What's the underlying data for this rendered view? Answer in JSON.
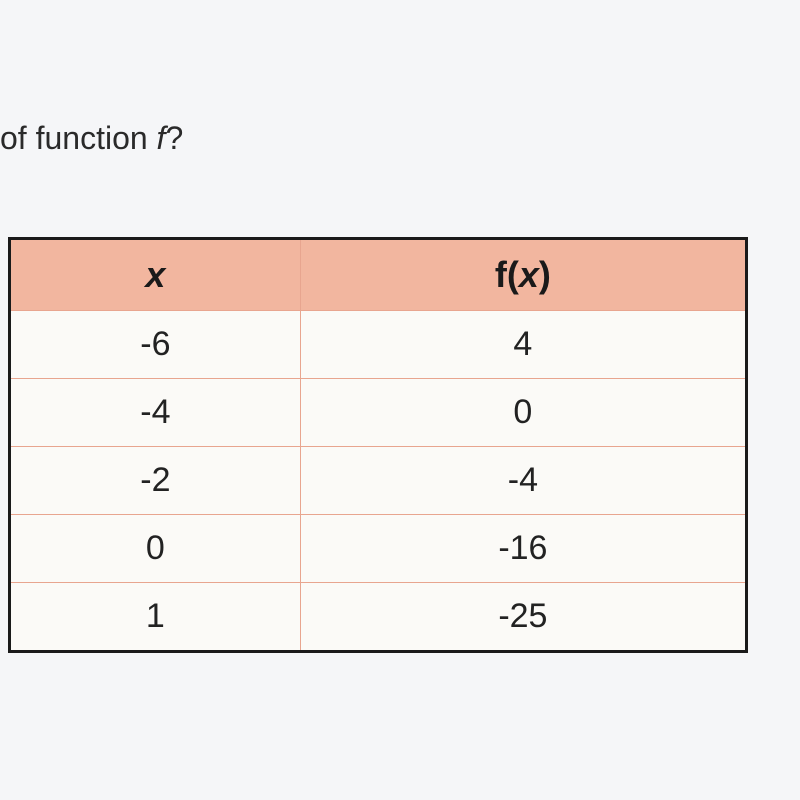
{
  "question": {
    "text_fragment": "of function ",
    "emph": "f",
    "trailing": "?"
  },
  "table": {
    "headers": {
      "x": "x",
      "fx_prefix": "f(",
      "fx_var": "x",
      "fx_suffix": ")"
    },
    "rows": [
      {
        "x": "-6",
        "fx": "4"
      },
      {
        "x": "-4",
        "fx": "0"
      },
      {
        "x": "-2",
        "fx": "-4"
      },
      {
        "x": "0",
        "fx": "-16"
      },
      {
        "x": "1",
        "fx": "-25"
      }
    ]
  },
  "chart_data": {
    "type": "table",
    "columns": [
      "x",
      "f(x)"
    ],
    "rows": [
      [
        -6,
        4
      ],
      [
        -4,
        0
      ],
      [
        -2,
        -4
      ],
      [
        0,
        -16
      ],
      [
        1,
        -25
      ]
    ]
  }
}
